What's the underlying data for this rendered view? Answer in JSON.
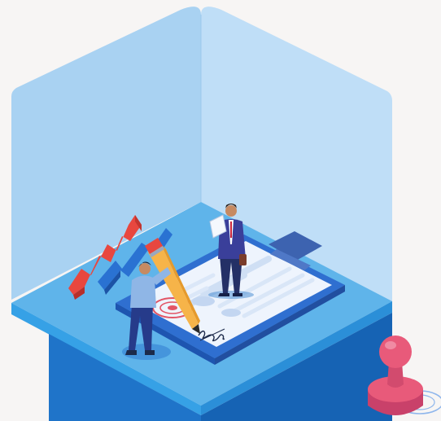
{
  "colors": {
    "background": "#f7f5f4",
    "wall_left": "#a9d2f2",
    "wall_right": "#bfdef7",
    "platform_top": "#5fb4ea",
    "platform_front_left": "#1f74c9",
    "platform_front_right": "#1663b4",
    "clipboard": "#2f6fd0",
    "paper": "#eef4fd",
    "chart_red": "#e8473f",
    "chart_blue": "#2a72d2",
    "pencil": "#f6b449",
    "stamp": "#e85a7a",
    "suit": "#2f3f8a",
    "shirt": "#8fb6e6"
  },
  "icons": {
    "chart": "rising-chart-icon",
    "clipboard": "clipboard-icon",
    "pencil": "pencil-icon",
    "stamp": "rubber-stamp-icon",
    "signature": "signature-icon",
    "seal": "seal-mark-icon"
  }
}
